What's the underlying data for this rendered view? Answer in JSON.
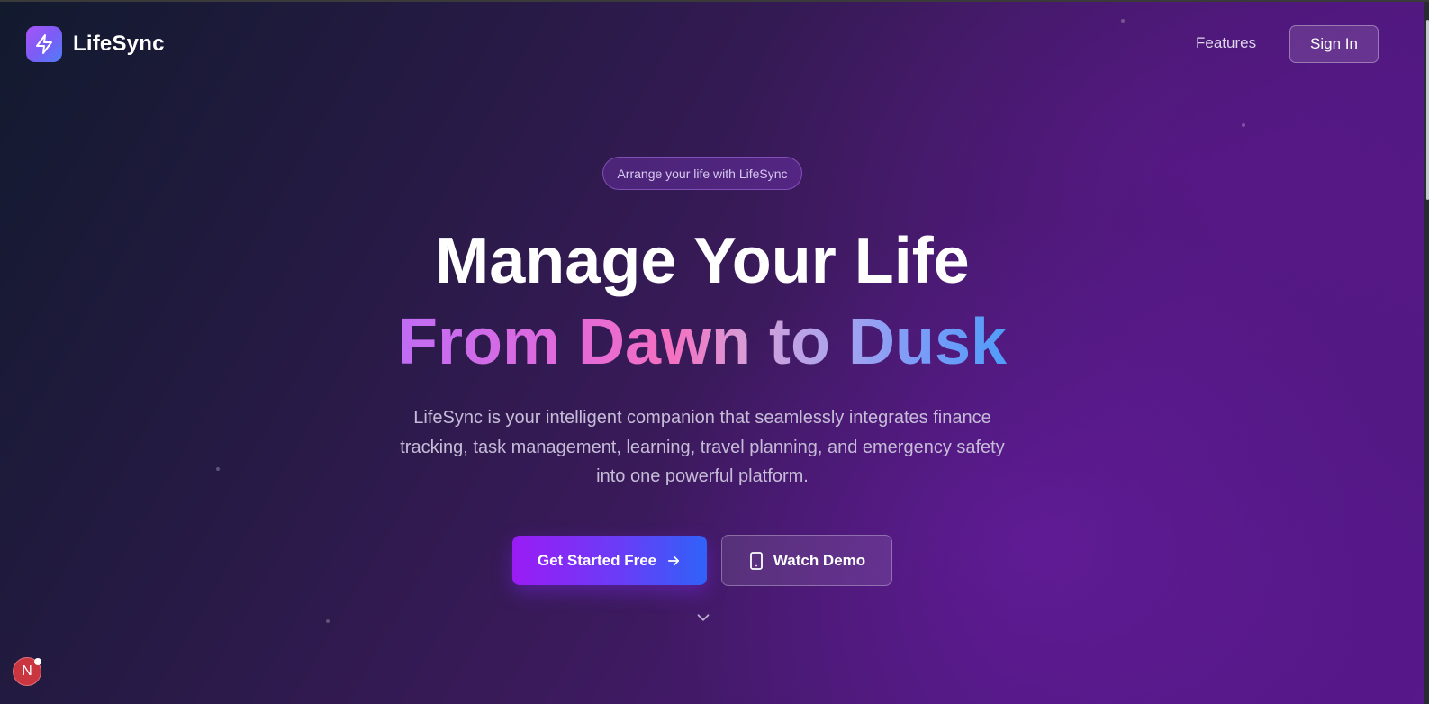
{
  "header": {
    "brand": "LifeSync",
    "nav_features": "Features",
    "signin_label": "Sign In"
  },
  "hero": {
    "pill_text": "Arrange your life with LifeSync",
    "headline_line1": "Manage Your Life",
    "headline_line2": "From Dawn to Dusk",
    "description": "LifeSync is your intelligent companion that seamlessly integrates finance tracking, task management, learning, travel planning, and emergency safety into one powerful platform.",
    "cta_primary": "Get Started Free",
    "cta_secondary": "Watch Demo"
  },
  "floating": {
    "avatar_letter": "N"
  },
  "icons": {
    "logo": "lightning-bolt-icon",
    "cta_primary": "arrow-right-icon",
    "cta_secondary": "smartphone-icon",
    "scroll": "chevron-down-icon"
  },
  "colors": {
    "brand_gradient_start": "#a855f7",
    "brand_gradient_end": "#4f7df7",
    "cta_gradient_start": "#9a1cf5",
    "cta_gradient_end": "#2f62f8",
    "headline_gradient": [
      "#c06cf5",
      "#f470c0",
      "#a9a4ee",
      "#4f9df8"
    ],
    "avatar_red": "#c9363f"
  }
}
